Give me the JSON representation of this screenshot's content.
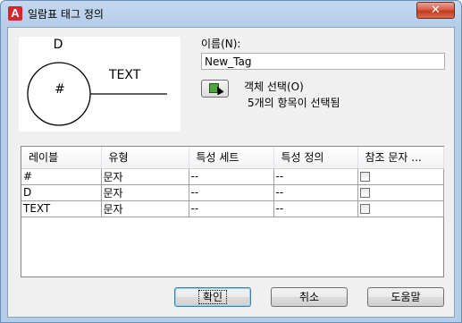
{
  "window": {
    "title": "일람표 태그 정의",
    "app_icon_letter": "A",
    "close_glyph": "✕"
  },
  "preview": {
    "labels": [
      "D",
      "#",
      "TEXT"
    ]
  },
  "name": {
    "label": "이름(N):",
    "value": "New_Tag"
  },
  "object_select": {
    "label": "객체 선택(O)",
    "status": "5개의 항목이 선택됨"
  },
  "grid": {
    "columns": [
      "레이블",
      "유형",
      "특성 세트",
      "특성 정의",
      "참조 문자 ..."
    ],
    "rows": [
      {
        "label": "#",
        "type": "문자",
        "set": "--",
        "def": "--"
      },
      {
        "label": "D",
        "type": "문자",
        "set": "--",
        "def": "--"
      },
      {
        "label": "TEXT",
        "type": "문자",
        "set": "--",
        "def": "--"
      }
    ]
  },
  "buttons": {
    "ok": "확인",
    "cancel": "취소",
    "help": "도움말"
  }
}
